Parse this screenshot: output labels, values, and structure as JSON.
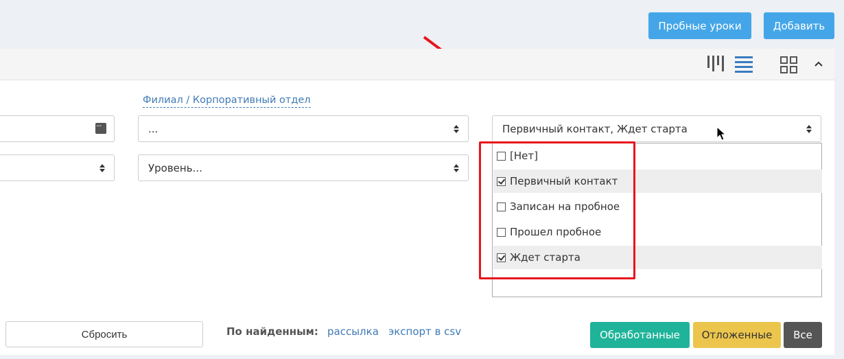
{
  "header": {
    "trial_lessons_label": "Пробные уроки",
    "add_label": "Добавить"
  },
  "filters": {
    "branch_link": "Филиал / Корпоративный отдел",
    "branch_value": "...",
    "status_value": "Первичный контакт, Ждет старта",
    "level_placeholder": "Уровень..."
  },
  "status_options": [
    {
      "label": "[Нет]",
      "checked": false
    },
    {
      "label": "Первичный контакт",
      "checked": true
    },
    {
      "label": "Записан на пробное",
      "checked": false
    },
    {
      "label": "Прошел пробное",
      "checked": false
    },
    {
      "label": "Ждет старта",
      "checked": true
    }
  ],
  "footer": {
    "reset_label": "Сбросить",
    "found_label": "По найденным:",
    "mailing_link": "рассылка",
    "csv_link": "экспорт в csv",
    "processed_label": "Обработанные",
    "postponed_label": "Отложенные",
    "all_label": "Все"
  },
  "colors": {
    "accent_blue": "#44a6e8",
    "processed_green": "#1fb39a",
    "postponed_yellow": "#ecc54d",
    "all_dark": "#555555",
    "annotation_red": "#e8141b",
    "link_blue": "#3f7ab5"
  },
  "icons": [
    "kanban-view-icon",
    "list-view-icon",
    "grid-view-icon",
    "chevron-up-icon",
    "calendar-icon"
  ]
}
